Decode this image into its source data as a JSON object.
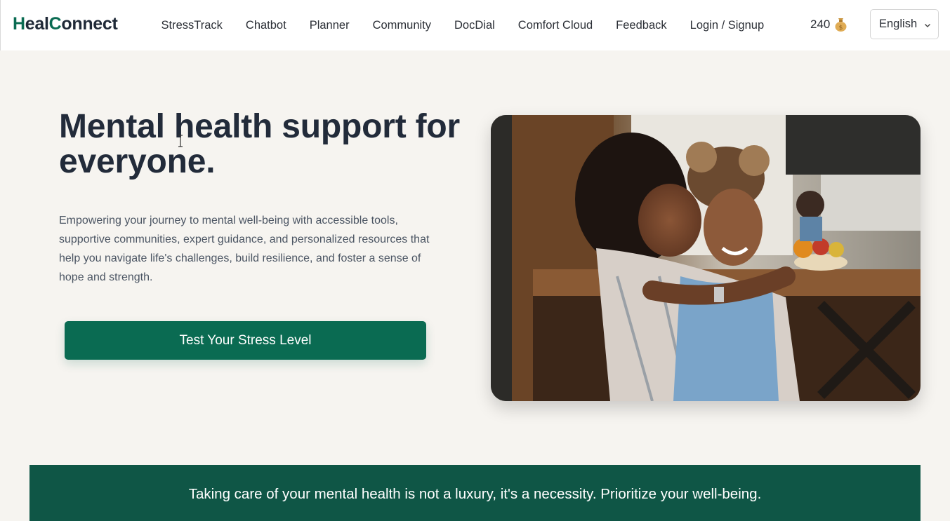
{
  "brand": {
    "name_part1": "H",
    "name_part2": "eal",
    "name_part3": "C",
    "name_part4": "onnect"
  },
  "nav": {
    "items": [
      {
        "label": "StressTrack",
        "name": "nav-stresstrack"
      },
      {
        "label": "Chatbot",
        "name": "nav-chatbot"
      },
      {
        "label": "Planner",
        "name": "nav-planner"
      },
      {
        "label": "Community",
        "name": "nav-community"
      },
      {
        "label": "DocDial",
        "name": "nav-docdial"
      },
      {
        "label": "Comfort Cloud",
        "name": "nav-comfort-cloud"
      },
      {
        "label": "Feedback",
        "name": "nav-feedback"
      },
      {
        "label": "Login / Signup",
        "name": "nav-login-signup"
      }
    ],
    "coins": "240",
    "coin_icon": "money-bag-icon",
    "language": "English"
  },
  "hero": {
    "title": "Mental health support for everyone.",
    "description": "Empowering your journey to mental well-being with accessible tools, supportive communities, expert guidance, and personalized resources that help you navigate life's challenges, build resilience, and foster a sense of hope and strength.",
    "cta_label": "Test Your Stress Level"
  },
  "banner": {
    "text": "Taking care of your mental health is not a luxury, it's a necessity. Prioritize your well-being."
  },
  "colors": {
    "brand_green": "#0a6b52",
    "banner_green": "#0f5646",
    "page_bg": "#f6f4f0",
    "heading": "#222b3a"
  }
}
